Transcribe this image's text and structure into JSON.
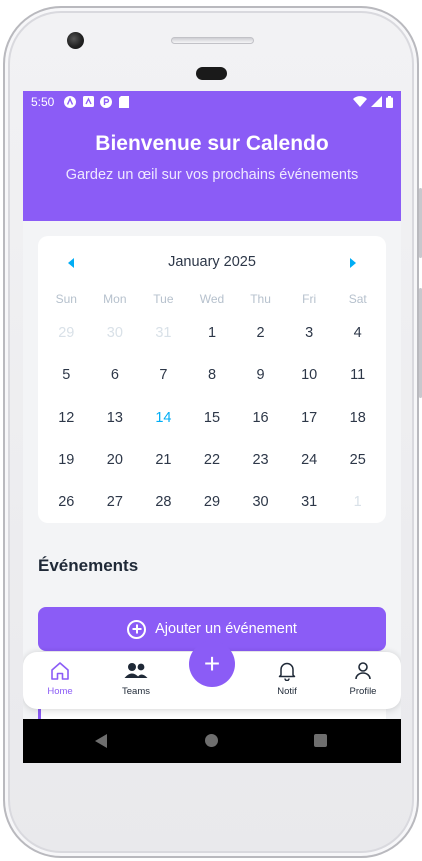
{
  "status_bar": {
    "time": "5:50",
    "icons": [
      "app-icon-a",
      "app-icon-box",
      "app-icon-p",
      "sd-card-icon"
    ],
    "right_icons": [
      "wifi-icon",
      "signal-icon",
      "battery-icon"
    ]
  },
  "header": {
    "title": "Bienvenue sur Calendo",
    "subtitle": "Gardez un œil sur vos prochains événements"
  },
  "calendar": {
    "month": "January 2025",
    "prev_icon": "caret-left-icon",
    "next_icon": "caret-right-icon",
    "weekdays": [
      "Sun",
      "Mon",
      "Tue",
      "Wed",
      "Thu",
      "Fri",
      "Sat"
    ],
    "today": "14",
    "days": [
      {
        "label": "29",
        "muted": true
      },
      {
        "label": "30",
        "muted": true
      },
      {
        "label": "31",
        "muted": true
      },
      {
        "label": "1"
      },
      {
        "label": "2"
      },
      {
        "label": "3"
      },
      {
        "label": "4"
      },
      {
        "label": "5"
      },
      {
        "label": "6"
      },
      {
        "label": "7"
      },
      {
        "label": "8"
      },
      {
        "label": "9"
      },
      {
        "label": "10"
      },
      {
        "label": "11"
      },
      {
        "label": "12"
      },
      {
        "label": "13"
      },
      {
        "label": "14",
        "today": true
      },
      {
        "label": "15"
      },
      {
        "label": "16"
      },
      {
        "label": "17"
      },
      {
        "label": "18"
      },
      {
        "label": "19"
      },
      {
        "label": "20"
      },
      {
        "label": "21"
      },
      {
        "label": "22"
      },
      {
        "label": "23"
      },
      {
        "label": "24"
      },
      {
        "label": "25"
      },
      {
        "label": "26"
      },
      {
        "label": "27"
      },
      {
        "label": "28"
      },
      {
        "label": "29"
      },
      {
        "label": "30"
      },
      {
        "label": "31"
      },
      {
        "label": "1",
        "muted": true
      }
    ]
  },
  "events": {
    "section_title": "Événements",
    "add_button_label": "Ajouter un événement",
    "add_button_icon": "plus-circle-icon"
  },
  "tab_bar": {
    "tabs": [
      {
        "label": "Home",
        "icon": "home-icon",
        "active": true
      },
      {
        "label": "Teams",
        "icon": "users-icon"
      },
      {
        "label": "Notif",
        "icon": "bell-icon"
      },
      {
        "label": "Profile",
        "icon": "user-icon"
      }
    ],
    "fab_label": "+"
  },
  "colors": {
    "primary": "#8b5cf6",
    "today": "#00adf5",
    "muted_day": "#d9e1e8",
    "weekday": "#b6c1cd",
    "text": "#2d3748"
  },
  "nav_bar": {
    "icons": [
      "back-icon",
      "home-circle-icon",
      "recent-apps-icon"
    ]
  }
}
